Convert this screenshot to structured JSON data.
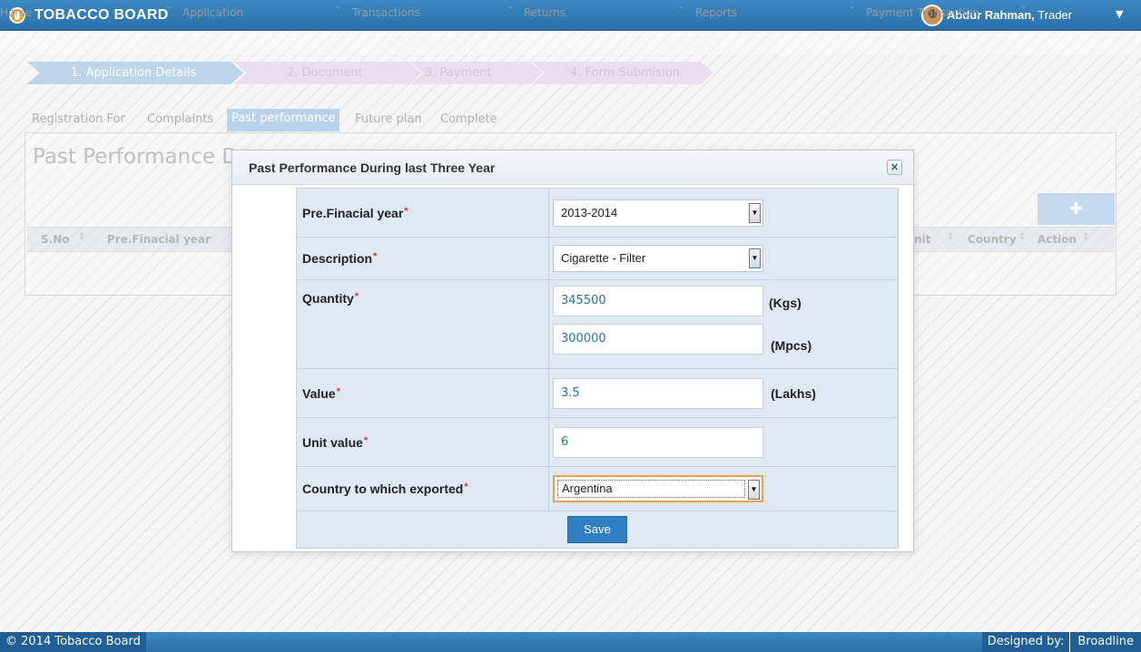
{
  "app": {
    "title": "TOBACCO BOARD"
  },
  "user": {
    "name": "Abdur Rahman,",
    "role": "Trader"
  },
  "nav": [
    "Home",
    "Application",
    "Transactions",
    "Returns",
    "Reports",
    "Payment Transaction"
  ],
  "steps": [
    "1. Application Details",
    "2. Document",
    "3. Payment",
    "4. Form Submision"
  ],
  "tabs": [
    "Registration For",
    "Complaints",
    "Past performance",
    "Future plan",
    "Complete"
  ],
  "background": {
    "panel_title": "Past Performance D",
    "add_icon": "plus-icon",
    "columns": [
      "S.No",
      "Pre.Finacial year",
      "nit",
      "Country",
      "Action"
    ]
  },
  "modal": {
    "title": "Past Performance During last Three Year",
    "close_icon": "close-icon",
    "fields": {
      "financial_year": {
        "label": "Pre.Finacial year",
        "value": "2013-2014"
      },
      "description": {
        "label": "Description",
        "value": "Cigarette - Filter"
      },
      "quantity": {
        "label": "Quantity",
        "kgs_value": "345500",
        "kgs_unit": "(Kgs)",
        "mpcs_value": "300000",
        "mpcs_unit": "(Mpcs)"
      },
      "value": {
        "label": "Value",
        "value": "3.5",
        "unit": "(Lakhs)"
      },
      "unit_value": {
        "label": "Unit value",
        "value": "6"
      },
      "country": {
        "label": "Country to which exported",
        "value": "Argentina"
      }
    },
    "required_mark": "*",
    "save_label": "Save"
  },
  "footer": {
    "copyright": "© 2014 Tobacco Board",
    "designed_by_label": "Designed by:",
    "designer": "Broadline"
  },
  "colors": {
    "header_blue": "#2a6fa8",
    "save_button": "#2e7fc3",
    "required": "#e03030",
    "focus_border": "#f0a050"
  }
}
